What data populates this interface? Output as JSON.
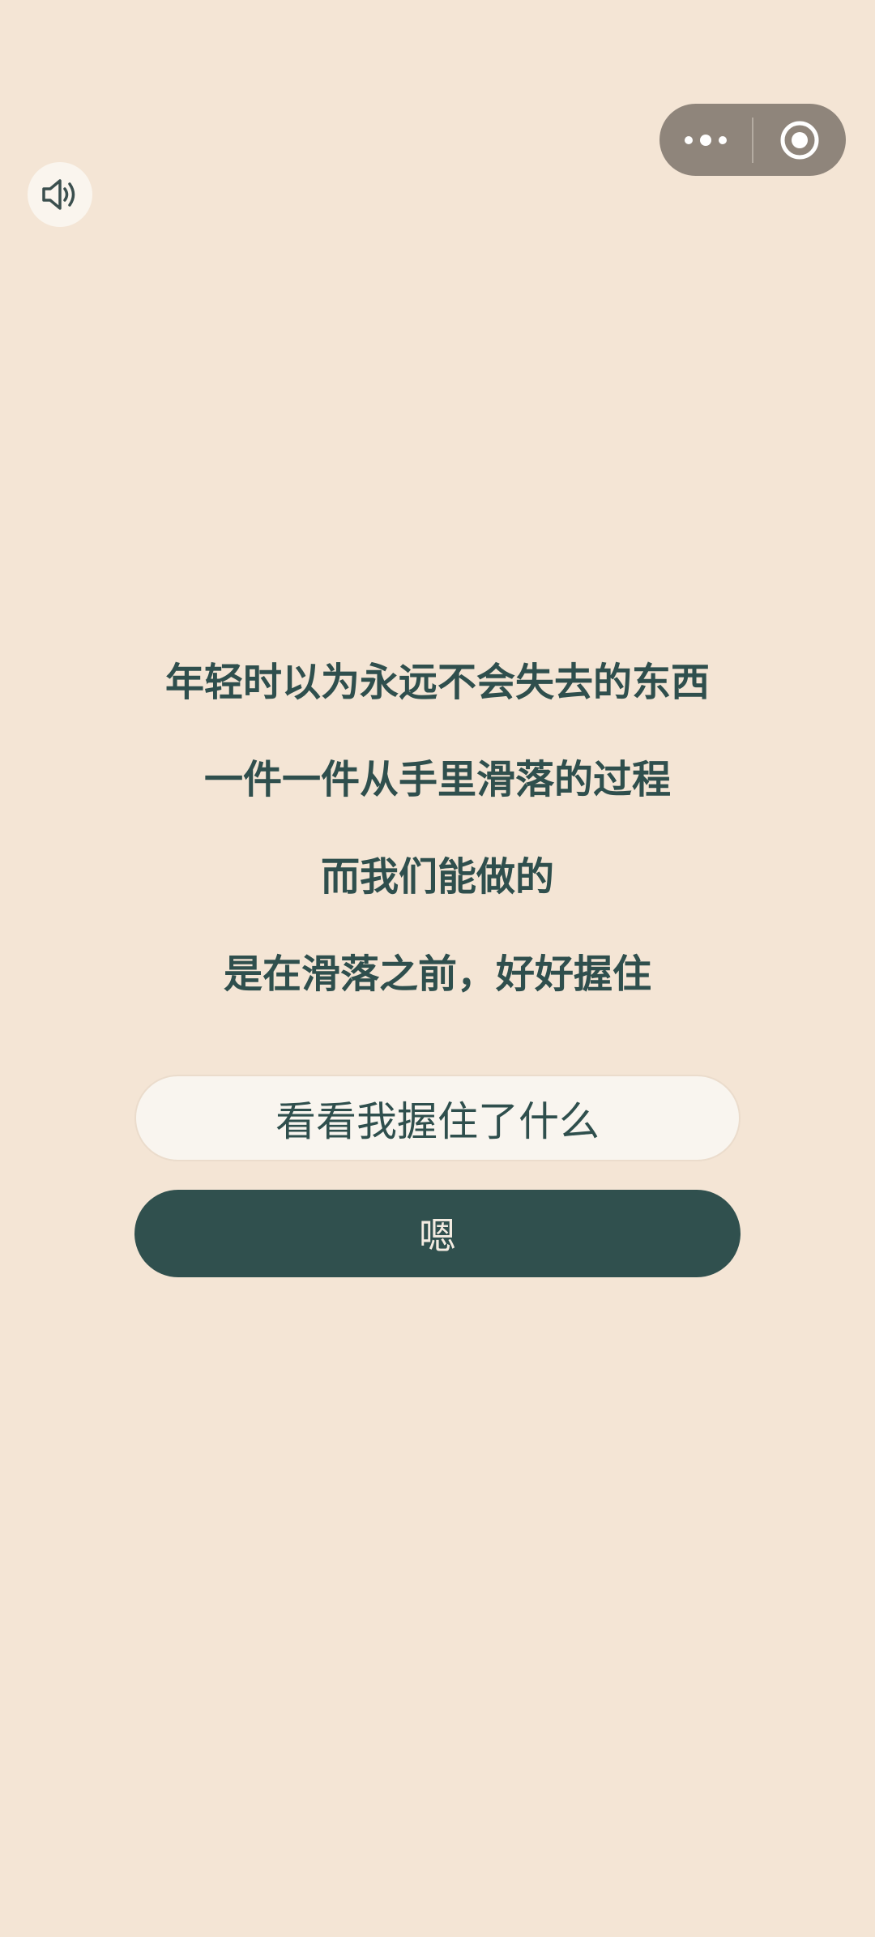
{
  "capsule": {
    "more_icon": "more-dots-icon",
    "close_icon": "target-circle-icon",
    "background": "#8f857b"
  },
  "sound": {
    "icon": "speaker-volume-icon"
  },
  "poem": {
    "lines": [
      "年轻时以为永远不会失去的东西",
      "一件一件从手里滑落的过程",
      "而我们能做的",
      "是在滑落之前，好好握住"
    ]
  },
  "buttons": {
    "secondary_label": "看看我握住了什么",
    "primary_label": "嗯"
  },
  "colors": {
    "background": "#f4e5d5",
    "accent_dark": "#30504e",
    "text": "#2f4f4d"
  }
}
